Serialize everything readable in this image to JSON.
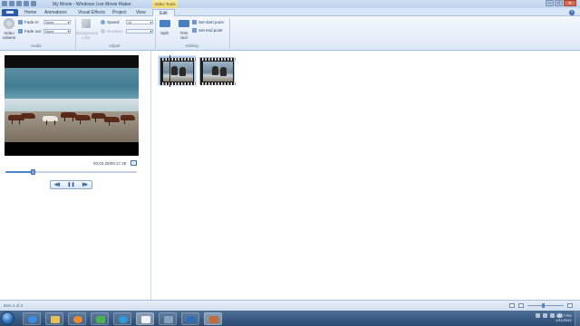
{
  "window": {
    "title": "My Movie - Windows Live Movie Maker",
    "context_tab_group": "Video Tools"
  },
  "tabs": [
    {
      "label": "Home"
    },
    {
      "label": "Animations"
    },
    {
      "label": "Visual Effects"
    },
    {
      "label": "Project"
    },
    {
      "label": "View"
    },
    {
      "label": "Edit",
      "active": true
    }
  ],
  "ribbon": {
    "video_volume_label": "Video volume",
    "fade_in_label": "Fade in:",
    "fade_in_value": "None",
    "fade_out_label": "Fade out:",
    "fade_out_value": "None",
    "audio_group_label": "Audio",
    "background_color_label": "Background color",
    "speed_label": "Speed:",
    "speed_value": "1x",
    "duration_label": "Duration:",
    "adjust_group_label": "Adjust",
    "split_label": "Split",
    "trim_tool_label": "Trim tool",
    "set_start_point_label": "Set start point",
    "set_end_point_label": "Set end point",
    "editing_group_label": "Editing"
  },
  "preview": {
    "timecode": "00:03.28/00:17.28",
    "progress_fraction": 0.21
  },
  "status": {
    "item_count": "Item 1 of 2"
  },
  "taskbar": {
    "time": "12:37 PM",
    "date": "1/11/2012"
  }
}
